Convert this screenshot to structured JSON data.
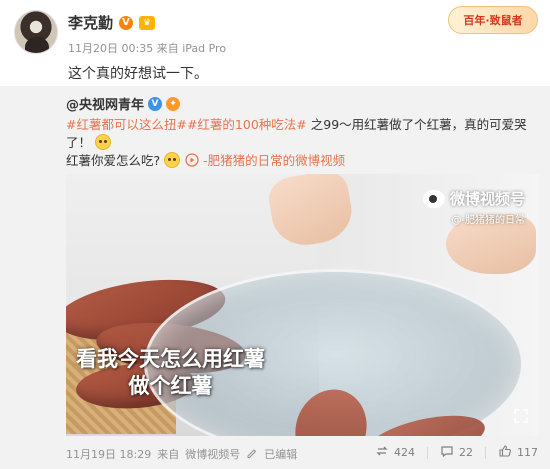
{
  "author": {
    "name": "李克勤",
    "time": "11月20日 00:35",
    "source_prefix": "来自",
    "source": "iPad Pro"
  },
  "decor_badge": "百年·致鼠者",
  "post": {
    "text": "这个真的好想试一下。"
  },
  "retweet": {
    "user": "@央视网青年",
    "hashtag1": "#红薯都可以这么扭#",
    "hashtag2": "#红薯的100种吃法#",
    "body": "之99～用红薯做了个红薯，真的可爱哭了！",
    "question": "红薯你爱怎么吃?",
    "video_link": "-肥猪猪的日常的微博视频",
    "video": {
      "watermark_title": "微博视频号",
      "watermark_sub": "@-肥猪猪的日常",
      "caption_line1": "看我今天怎么用红薯",
      "caption_line2": "做个红薯"
    },
    "footer": {
      "time": "11月19日 18:29",
      "source_prefix": "来自",
      "source": "微博视频号",
      "edit_label": "已编辑"
    },
    "actions": {
      "repost_count": "424",
      "comment_count": "22",
      "like_count": "117"
    }
  },
  "colors": {
    "accent_link": "#eb7350",
    "vip_orange": "#ff8200",
    "verified_blue": "#3d93ec",
    "retweet_bg": "#f2f2f2"
  }
}
